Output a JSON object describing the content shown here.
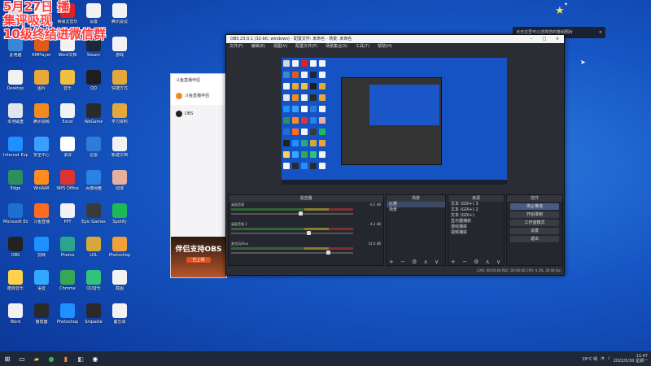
{
  "overlay_lines": [
    "5月27日 播",
    "集评吸现",
    "10级终结进微信群"
  ],
  "notification": {
    "text": "点击这里可以选择您的整组照片",
    "close": "×"
  },
  "desktop_icons": [
    {
      "label": "回收站",
      "color": "#cfd8e4"
    },
    {
      "label": "此电脑",
      "color": "#3a86d8"
    },
    {
      "label": "Desktop",
      "color": "#f2f2f2"
    },
    {
      "label": "本地磁盘",
      "color": "#e2e6ec"
    },
    {
      "label": "Internet Explorer",
      "color": "#1e90ff"
    },
    {
      "label": "Edge",
      "color": "#2d8f5d"
    },
    {
      "label": "Microsoft Edge",
      "color": "#1f6fd0"
    },
    {
      "label": "OBS",
      "color": "#222222"
    },
    {
      "label": "酷狗音乐",
      "color": "#ffd24a"
    },
    {
      "label": "Word",
      "color": "#f2f2f2"
    },
    {
      "label": "文档",
      "color": "#f2f2f2"
    },
    {
      "label": "KMPlayer",
      "color": "#e05a1a"
    },
    {
      "label": "图片",
      "color": "#e8a93a"
    },
    {
      "label": "腾讯视频",
      "color": "#f28a1e"
    },
    {
      "label": "安全中心",
      "color": "#3aa0ff"
    },
    {
      "label": "WinRAR",
      "color": "#ff8a1e"
    },
    {
      "label": "斗鱼直播",
      "color": "#ff6a1e"
    },
    {
      "label": "剪映",
      "color": "#1e90ff"
    },
    {
      "label": "语音",
      "color": "#34a8ff"
    },
    {
      "label": "播放器",
      "color": "#2a2a2a"
    },
    {
      "label": "网易云音乐",
      "color": "#e02020"
    },
    {
      "label": "Word文档",
      "color": "#f2f2f2"
    },
    {
      "label": "音乐",
      "color": "#f0c040"
    },
    {
      "label": "Excel",
      "color": "#f2f2f2"
    },
    {
      "label": "录屏",
      "color": "#ffffff"
    },
    {
      "label": "WPS Office",
      "color": "#d33"
    },
    {
      "label": "PPT",
      "color": "#f2f2f2"
    },
    {
      "label": "Photos",
      "color": "#2ca58d"
    },
    {
      "label": "Chrome",
      "color": "#34a853"
    },
    {
      "label": "Photoshop",
      "color": "#1e90ff"
    },
    {
      "label": "设置",
      "color": "#f2f2f2"
    },
    {
      "label": "Steam",
      "color": "#1b2838"
    },
    {
      "label": "QQ",
      "color": "#1e1e1e"
    },
    {
      "label": "WeGame",
      "color": "#2a2a2a"
    },
    {
      "label": "迅雷",
      "color": "#2e7bd8"
    },
    {
      "label": "百度网盘",
      "color": "#2a82e4"
    },
    {
      "label": "Epic Games",
      "color": "#3a3a3a"
    },
    {
      "label": "LOL",
      "color": "#d4a83a"
    },
    {
      "label": "QQ音乐",
      "color": "#31c27c"
    },
    {
      "label": "Snipaste",
      "color": "#2a2a2a"
    },
    {
      "label": "腾讯会议",
      "color": "#f2f2f2"
    },
    {
      "label": "游戏",
      "color": "#f2f2f2"
    },
    {
      "label": "快捷方式",
      "color": "#e2a83a"
    },
    {
      "label": "学习资料",
      "color": "#e2a83a"
    },
    {
      "label": "新建文档",
      "color": "#f2f2f2"
    },
    {
      "label": "动漫",
      "color": "#e6b0a0"
    },
    {
      "label": "Spotify",
      "color": "#1db954"
    },
    {
      "label": "Photoshop",
      "color": "#f2a13a"
    },
    {
      "label": "截图",
      "color": "#f2f2f2"
    },
    {
      "label": "备忘录",
      "color": "#f2f2f2"
    }
  ],
  "sidepanel": {
    "title": "斗鱼直播伴侣",
    "items": [
      {
        "label": "斗鱼直播伴侣",
        "color": "#f28a1e"
      },
      {
        "label": "OBS",
        "color": "#222222"
      }
    ],
    "banner_title": "伴侣支持OBS",
    "banner_button": "已上线"
  },
  "obs": {
    "title": "OBS 23.0.1 (32-bit, windows) - 配置文件: 未命名 - 场景: 未命名",
    "window_buttons": [
      "–",
      "□",
      "×"
    ],
    "menu": [
      "文件(F)",
      "编辑(E)",
      "视图(V)",
      "配置文件(P)",
      "场景集合(S)",
      "工具(T)",
      "帮助(H)"
    ],
    "mixer": {
      "title": "混音器",
      "rows": [
        {
          "name": "桌面音频",
          "db": "-6.2 dB",
          "level": 0.55
        },
        {
          "name": "桌面音频 2",
          "db": "-4.2 dB",
          "level": 0.62
        },
        {
          "name": "麦克风/Aux",
          "db": "14.0 dB",
          "level": 0.78
        }
      ]
    },
    "scenes": {
      "title": "场景",
      "items": [
        "比赛",
        "场景"
      ]
    },
    "sources": {
      "title": "来源",
      "items": [
        "文本 (GDI+) 3",
        "文本 (GDI+) 2",
        "文本 (GDI+)",
        "显示器捕获",
        "游戏捕获",
        "视频捕获"
      ]
    },
    "controls": {
      "title": "控件",
      "buttons": [
        "停止推流",
        "开始录制",
        "工作室模式",
        "设置",
        "退出"
      ]
    },
    "footer_glyphs": "+ − ⚙ ∧ ∨",
    "status": "LIVE: 00:00:00    REC: 00:00:00    CPU: 4.3%, 30.00 fps"
  },
  "taskbar": {
    "time": "11:47",
    "date": "2022/5/30 星期一",
    "weather": "29°C 晴"
  }
}
